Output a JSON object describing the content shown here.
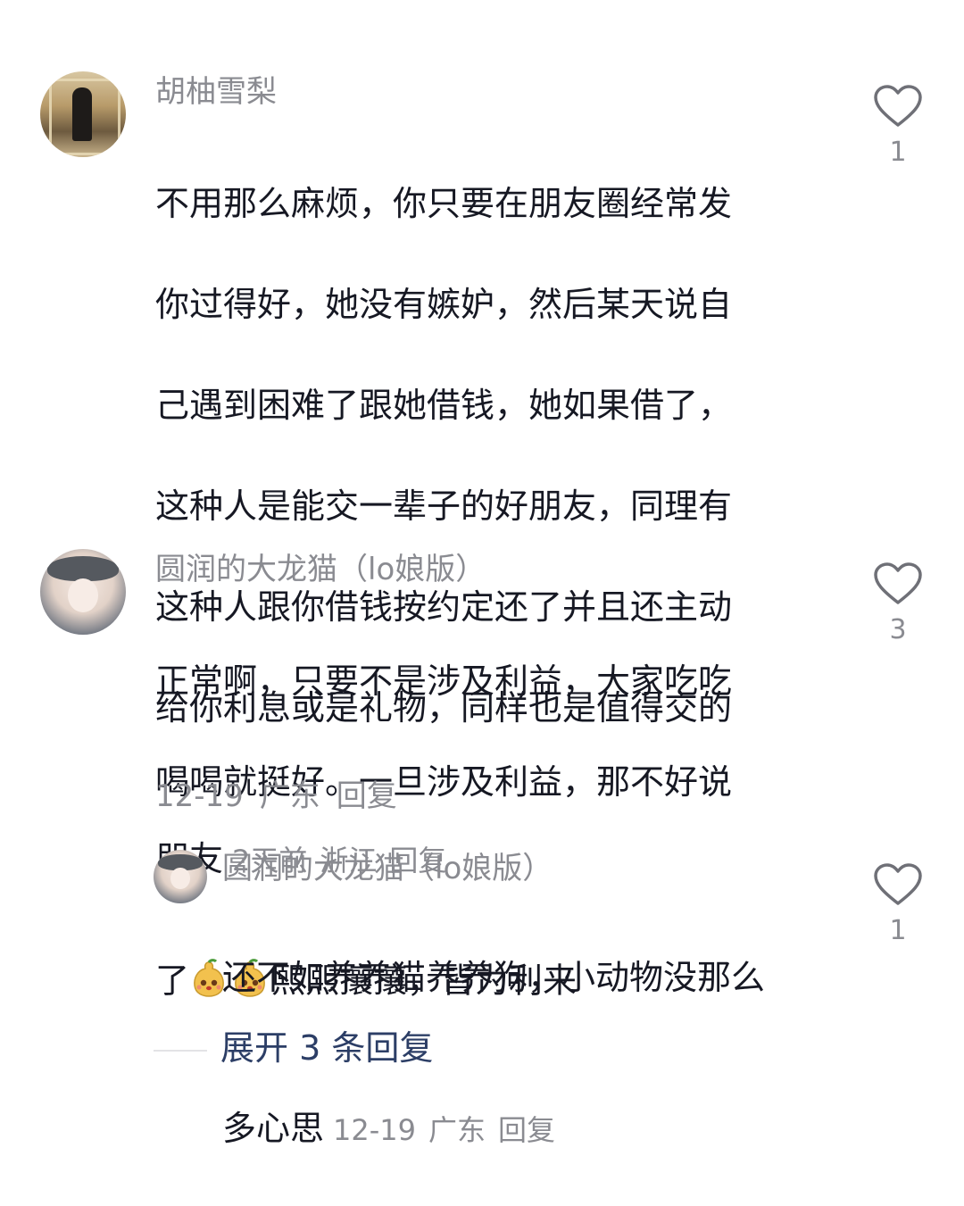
{
  "comments": [
    {
      "username": "胡柚雪梨",
      "text_lines": [
        "不用那么麻烦，你只要在朋友圈经常发",
        "你过得好，她没有嫉妒，然后某天说自",
        "己遇到困难了跟她借钱，她如果借了，",
        "这种人是能交一辈子的好朋友，同理有",
        "这种人跟你借钱按约定还了并且还主动",
        "给你利息或是礼物，同样也是值得交的"
      ],
      "last_line": "朋友",
      "time": "2天前",
      "location": "浙江",
      "reply_label": "回复",
      "likes": "1"
    },
    {
      "username": "圆润的大龙猫（lo娘版）",
      "text_lines": [
        "正常啊，只要不是涉及利益，大家吃吃",
        "喝喝就挺好。一旦涉及利益，那不好说"
      ],
      "line3_prefix": "了",
      "line3_suffix": "熙熙攘攘，皆为利来",
      "time": "12-19",
      "location": "广东",
      "reply_label": "回复",
      "likes": "3"
    }
  ],
  "reply": {
    "username": "圆润的大龙猫（lo娘版）",
    "text_line1": "还不如养养猫养养狗，小动物没那么",
    "text_line2": "多心思",
    "time": "12-19",
    "location": "广东",
    "reply_label": "回复",
    "likes": "1"
  },
  "expand_label": "展开 3 条回复",
  "icons": {
    "like": "heart-outline-icon",
    "emoji": "pear-face-emoji-icon"
  },
  "colors": {
    "text": "#161823",
    "meta": "#8a8b91",
    "expand": "#2c3e66"
  }
}
